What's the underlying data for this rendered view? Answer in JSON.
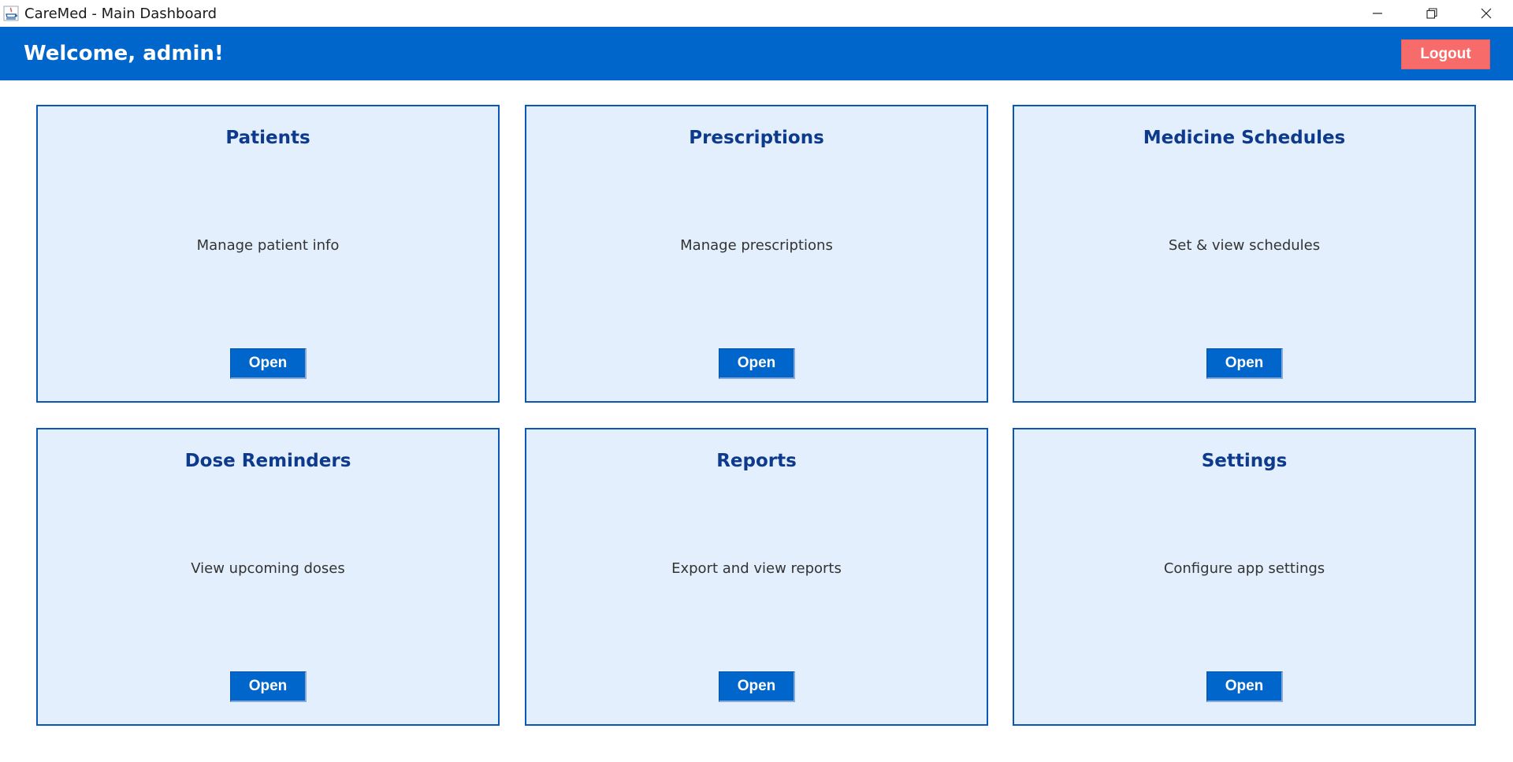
{
  "window": {
    "title": "CareMed - Main Dashboard",
    "icons": [
      "java-app-icon",
      "minimize-icon",
      "restore-icon",
      "close-icon"
    ]
  },
  "header": {
    "welcome": "Welcome, admin!",
    "logout_label": "Logout"
  },
  "cards": [
    {
      "title": "Patients",
      "description": "Manage patient info",
      "button": "Open"
    },
    {
      "title": "Prescriptions",
      "description": "Manage prescriptions",
      "button": "Open"
    },
    {
      "title": "Medicine Schedules",
      "description": "Set & view schedules",
      "button": "Open"
    },
    {
      "title": "Dose Reminders",
      "description": "View upcoming doses",
      "button": "Open"
    },
    {
      "title": "Reports",
      "description": "Export and view reports",
      "button": "Open"
    },
    {
      "title": "Settings",
      "description": "Configure app settings",
      "button": "Open"
    }
  ],
  "colors": {
    "header_bg": "#0066cc",
    "logout_bg": "#f86b6b",
    "card_bg": "#e3effc",
    "card_border": "#0a58b4",
    "card_title": "#0d3a8c",
    "button_bg": "#0066cc"
  }
}
